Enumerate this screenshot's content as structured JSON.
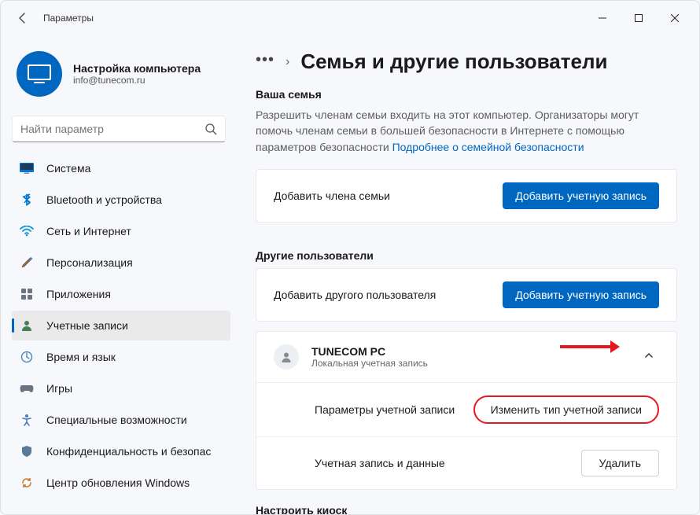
{
  "window": {
    "title": "Параметры"
  },
  "profile": {
    "name": "Настройка компьютера",
    "email": "info@tunecom.ru"
  },
  "search": {
    "placeholder": "Найти параметр"
  },
  "nav": [
    {
      "key": "system",
      "label": "Система"
    },
    {
      "key": "bluetooth",
      "label": "Bluetooth и устройства"
    },
    {
      "key": "network",
      "label": "Сеть и Интернет"
    },
    {
      "key": "personalize",
      "label": "Персонализация"
    },
    {
      "key": "apps",
      "label": "Приложения"
    },
    {
      "key": "accounts",
      "label": "Учетные записи",
      "active": true
    },
    {
      "key": "time",
      "label": "Время и язык"
    },
    {
      "key": "gaming",
      "label": "Игры"
    },
    {
      "key": "accessibility",
      "label": "Специальные возможности"
    },
    {
      "key": "privacy",
      "label": "Конфиденциальность и безопас"
    },
    {
      "key": "update",
      "label": "Центр обновления Windows"
    }
  ],
  "page": {
    "title": "Семья и другие пользователи"
  },
  "family": {
    "section_title": "Ваша семья",
    "desc_pre": "Разрешить членам семьи входить на этот компьютер. Организаторы могут помочь членам семьи в большей безопасности в Интернете с помощью параметров безопасности ",
    "desc_link": "Подробнее о семейной безопасности",
    "add_label": "Добавить члена семьи",
    "add_button": "Добавить учетную запись"
  },
  "others": {
    "section_title": "Другие пользователи",
    "add_label": "Добавить другого пользователя",
    "add_button": "Добавить учетную запись",
    "user": {
      "name": "TUNECOM PC",
      "type": "Локальная учетная запись"
    },
    "account_params_label": "Параметры учетной записи",
    "change_type_button": "Изменить тип учетной записи",
    "account_data_label": "Учетная запись и данные",
    "delete_button": "Удалить"
  },
  "kiosk": {
    "section_title": "Настроить киоск"
  }
}
